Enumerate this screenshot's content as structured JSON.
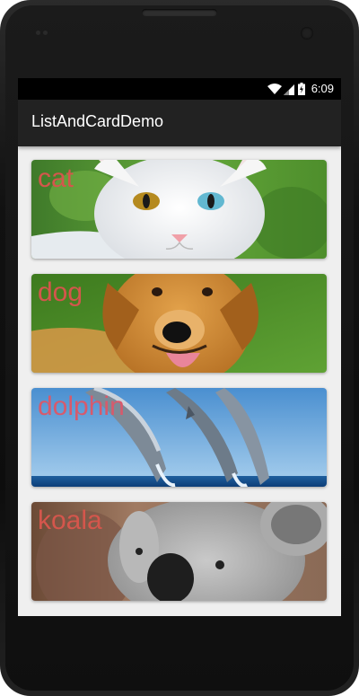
{
  "statusbar": {
    "time": "6:09",
    "icons": [
      "wifi-icon",
      "signal-icon",
      "battery-icon"
    ]
  },
  "appbar": {
    "title": "ListAndCardDemo"
  },
  "cards": [
    {
      "label": "cat"
    },
    {
      "label": "dog"
    },
    {
      "label": "dolphin"
    },
    {
      "label": "koala"
    }
  ],
  "colors": {
    "label": "#d4564c",
    "appbar": "#222222",
    "statusbar": "#000000",
    "list_bg": "#efefef"
  }
}
